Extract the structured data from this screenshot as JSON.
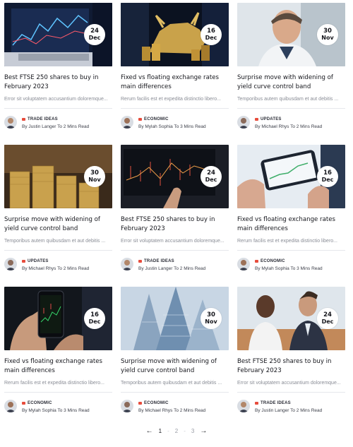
{
  "cards": [
    {
      "date_day": "24",
      "date_month": "Dec",
      "title": "Best FTSE 250 shares to buy in February 2023",
      "excerpt": "Error sit voluptatem accusantium doloremque...",
      "category": "TRADE IDEAS",
      "byline": "By Justin Langer To 2 Mins Read"
    },
    {
      "date_day": "16",
      "date_month": "Dec",
      "title": "Fixed vs floating exchange rates main differences",
      "excerpt": "Rerum facilis est et expedita distinctio libero...",
      "category": "ECONOMIC",
      "byline": "By Mylah Sophia To 3 Mins Read"
    },
    {
      "date_day": "30",
      "date_month": "Nov",
      "title": "Surprise move with widening of yield curve control band",
      "excerpt": "Temporibus autem quibusdam et aut debitis ...",
      "category": "UPDATES",
      "byline": "By Michael Rhys To 2 Mins Read"
    },
    {
      "date_day": "30",
      "date_month": "Nov",
      "title": "Surprise move with widening of yield curve control band",
      "excerpt": "Temporibus autem quibusdam et aut debitis ...",
      "category": "UPDATES",
      "byline": "By Michael Rhys To 2 Mins Read"
    },
    {
      "date_day": "24",
      "date_month": "Dec",
      "title": "Best FTSE 250 shares to buy in February 2023",
      "excerpt": "Error sit voluptatem accusantium doloremque...",
      "category": "TRADE IDEAS",
      "byline": "By Justin Langer To 2 Mins Read"
    },
    {
      "date_day": "16",
      "date_month": "Dec",
      "title": "Fixed vs floating exchange rates main differences",
      "excerpt": "Rerum facilis est et expedita distinctio libero...",
      "category": "ECONOMIC",
      "byline": "By Mylah Sophia To 3 Mins Read"
    },
    {
      "date_day": "16",
      "date_month": "Dec",
      "title": "Fixed vs floating exchange rates main differences",
      "excerpt": "Rerum facilis est et expedita distinctio libero...",
      "category": "ECONOMIC",
      "byline": "By Mylah Sophia To 3 Mins Read"
    },
    {
      "date_day": "30",
      "date_month": "Nov",
      "title": "Surprise move with widening of yield curve control band",
      "excerpt": "Temporibus autem quibusdam et aut debitis ...",
      "category": "ECONOMIC",
      "byline": "By Michael Rhys To 2 Mins Read"
    },
    {
      "date_day": "24",
      "date_month": "Dec",
      "title": "Best FTSE 250 shares to buy in February 2023",
      "excerpt": "Error sit voluptatem accusantium doloremque...",
      "category": "TRADE IDEAS",
      "byline": "By Justin Langer To 2 Mins Read"
    }
  ],
  "pagination": {
    "prev_icon": "←",
    "next_icon": "→",
    "pages": [
      "1",
      "2",
      "3"
    ],
    "separator": "-",
    "current": "1"
  },
  "colors": {
    "category_accent": "#e74c3c",
    "title": "#15161c",
    "excerpt": "#8a8d96"
  }
}
